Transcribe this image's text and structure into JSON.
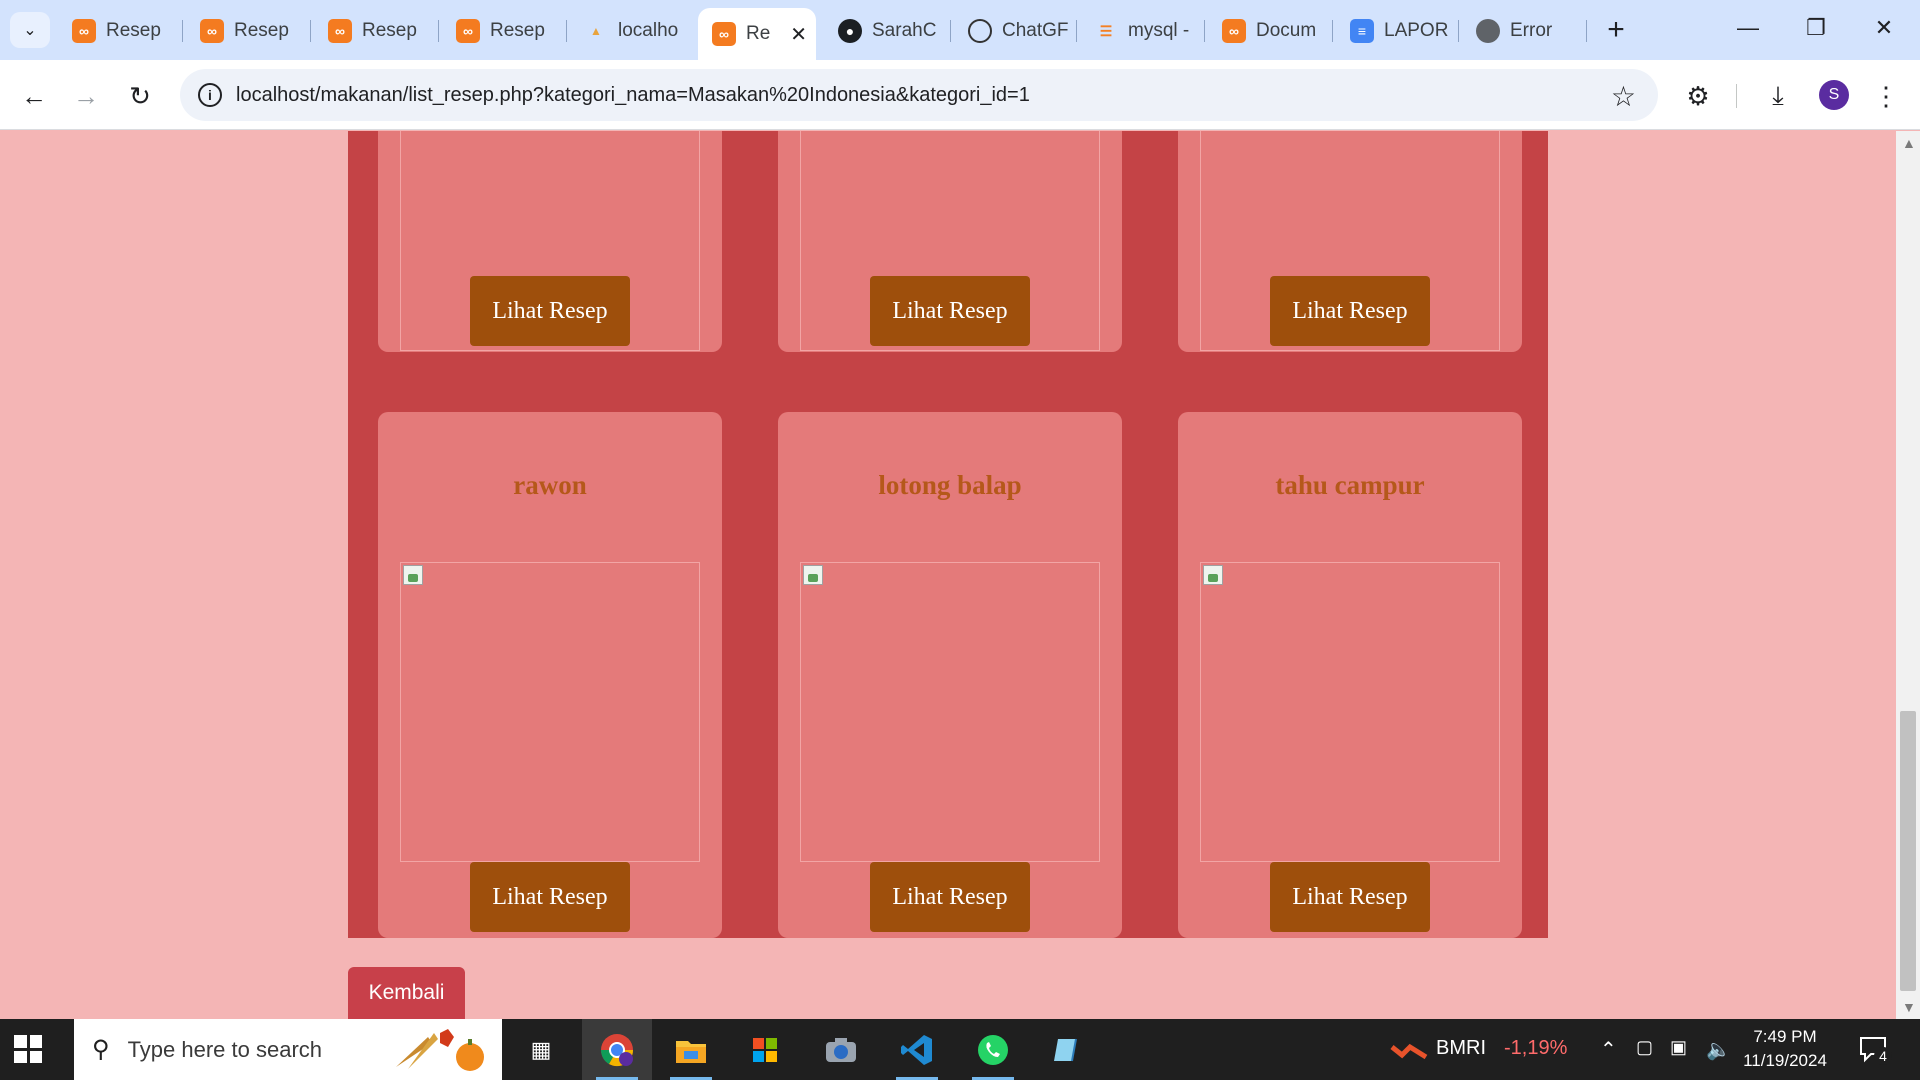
{
  "browser": {
    "tabs": [
      {
        "title": "Resep M",
        "icon": "xampp-icon"
      },
      {
        "title": "Resep M",
        "icon": "xampp-icon"
      },
      {
        "title": "Resep M",
        "icon": "xampp-icon"
      },
      {
        "title": "Resep M",
        "icon": "xampp-icon"
      },
      {
        "title": "localho",
        "icon": "phpmyadmin-icon"
      },
      {
        "title": "Re",
        "icon": "xampp-icon",
        "active": true
      },
      {
        "title": "SarahC",
        "icon": "github-icon"
      },
      {
        "title": "ChatGF",
        "icon": "chatgpt-icon"
      },
      {
        "title": "mysql -",
        "icon": "stackoverflow-icon"
      },
      {
        "title": "Docum",
        "icon": "xampp-icon"
      },
      {
        "title": "LAPOR",
        "icon": "google-docs-icon"
      },
      {
        "title": "Error",
        "icon": "globe-icon"
      }
    ],
    "url": "localhost/makanan/list_resep.php?kategori_nama=Masakan%20Indonesia&kategori_id=1",
    "profile_initial": "S"
  },
  "page": {
    "recipes_top_row": [
      {
        "name": "",
        "button": "Lihat Resep"
      },
      {
        "name": "",
        "button": "Lihat Resep"
      },
      {
        "name": "",
        "button": "Lihat Resep"
      }
    ],
    "recipes_bottom_row": [
      {
        "name": "rawon",
        "button": "Lihat Resep"
      },
      {
        "name": "lotong balap",
        "button": "Lihat Resep"
      },
      {
        "name": "tahu campur",
        "button": "Lihat Resep"
      }
    ],
    "back_button": "Kembali",
    "colors": {
      "page_bg": "#f4b5b5",
      "container_bg": "#c44346",
      "card_bg": "#e47a7a",
      "recipe_title": "#b5581a",
      "button_bg": "#9e4f0c",
      "back_button_bg": "#c8404a"
    }
  },
  "taskbar": {
    "search_placeholder": "Type here to search",
    "stock_ticker": "BMRI",
    "stock_change": "-1,19%",
    "time": "7:49 PM",
    "date": "11/19/2024",
    "notification_count": "4"
  }
}
